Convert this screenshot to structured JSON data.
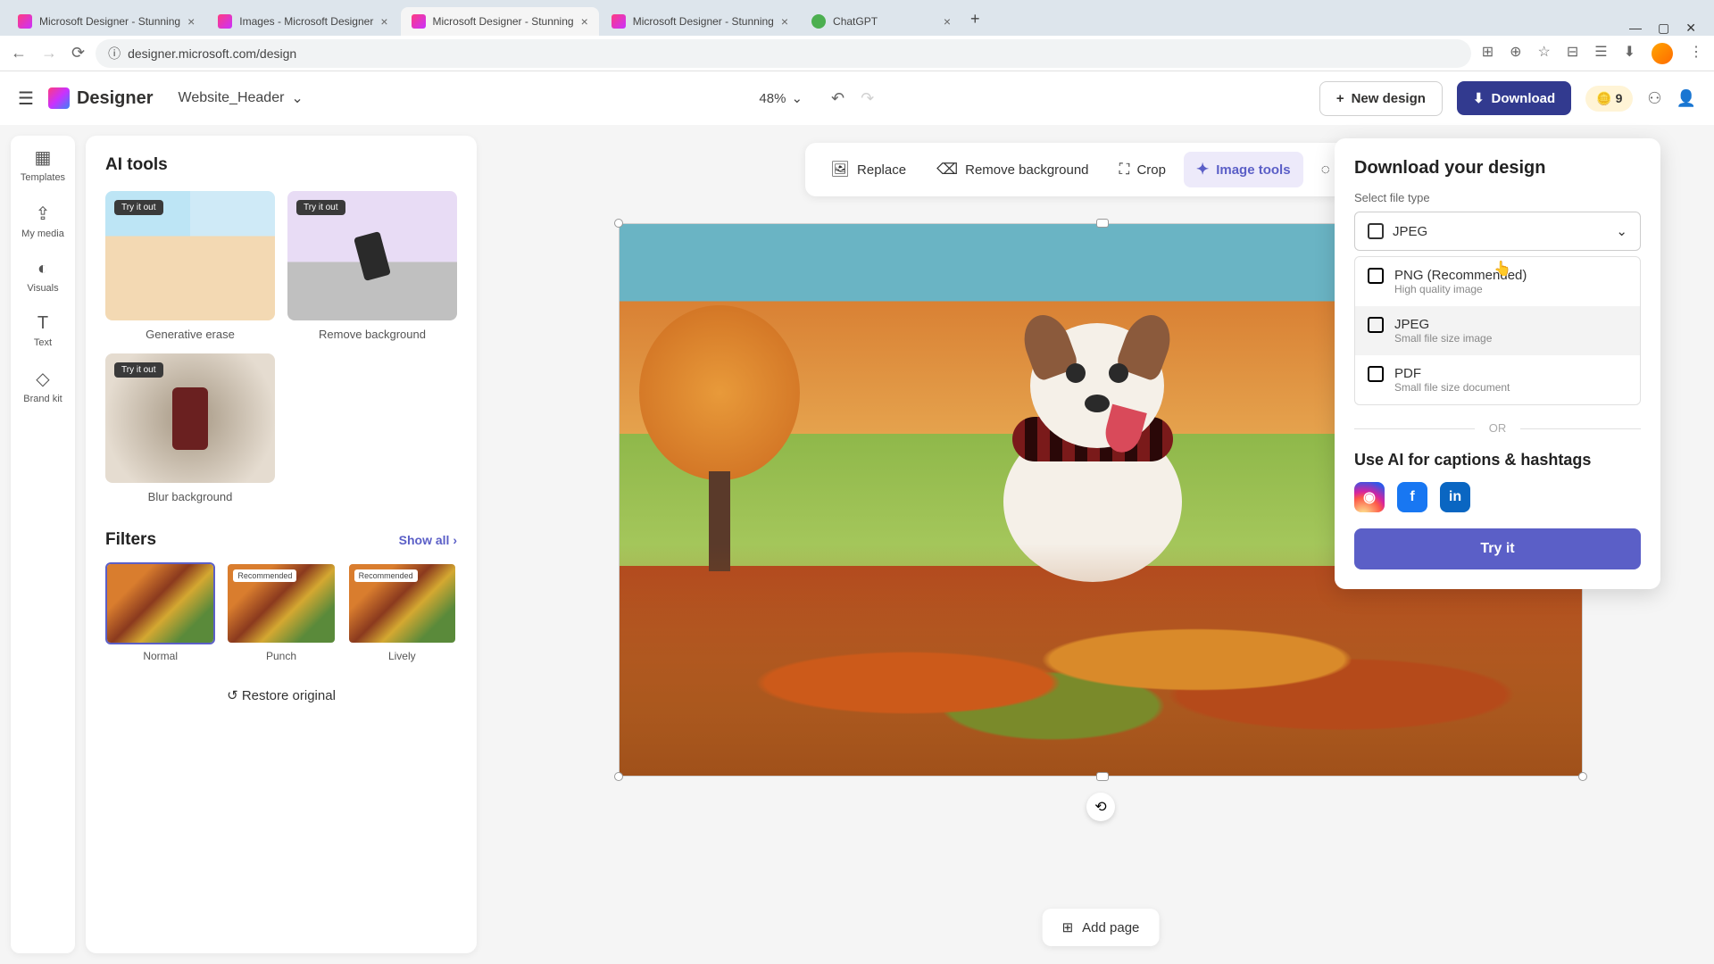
{
  "browser": {
    "tabs": [
      {
        "title": "Microsoft Designer - Stunning"
      },
      {
        "title": "Images - Microsoft Designer"
      },
      {
        "title": "Microsoft Designer - Stunning"
      },
      {
        "title": "Microsoft Designer - Stunning"
      },
      {
        "title": "ChatGPT"
      }
    ],
    "url": "designer.microsoft.com/design"
  },
  "header": {
    "app_name": "Designer",
    "project_name": "Website_Header",
    "zoom": "48%",
    "new_design": "New design",
    "download": "Download",
    "credits": "9"
  },
  "rail": {
    "items": [
      {
        "icon": "▦",
        "label": "Templates"
      },
      {
        "icon": "⇪",
        "label": "My media"
      },
      {
        "icon": "◐",
        "label": "Visuals"
      },
      {
        "icon": "T",
        "label": "Text"
      },
      {
        "icon": "◇",
        "label": "Brand kit"
      }
    ]
  },
  "side": {
    "ai_title": "AI tools",
    "try_badge": "Try it out",
    "ai_cards": [
      {
        "label": "Generative erase"
      },
      {
        "label": "Remove background"
      },
      {
        "label": "Blur background"
      }
    ],
    "filters_title": "Filters",
    "show_all": "Show all",
    "recommended_badge": "Recommended",
    "filters": [
      {
        "label": "Normal",
        "selected": true
      },
      {
        "label": "Punch",
        "recommended": true
      },
      {
        "label": "Lively",
        "recommended": true
      }
    ],
    "restore": "Restore original"
  },
  "toolbar": {
    "replace": "Replace",
    "remove_bg": "Remove background",
    "crop": "Crop",
    "image_tools": "Image tools"
  },
  "canvas": {
    "add_page": "Add page"
  },
  "download_popover": {
    "title": "Download your design",
    "select_label": "Select file type",
    "selected": "JPEG",
    "options": [
      {
        "title": "PNG (Recommended)",
        "sub": "High quality image"
      },
      {
        "title": "JPEG",
        "sub": "Small file size image"
      },
      {
        "title": "PDF",
        "sub": "Small file size document"
      }
    ],
    "or": "OR",
    "ai_caption_title": "Use AI for captions & hashtags",
    "try_it": "Try it"
  }
}
